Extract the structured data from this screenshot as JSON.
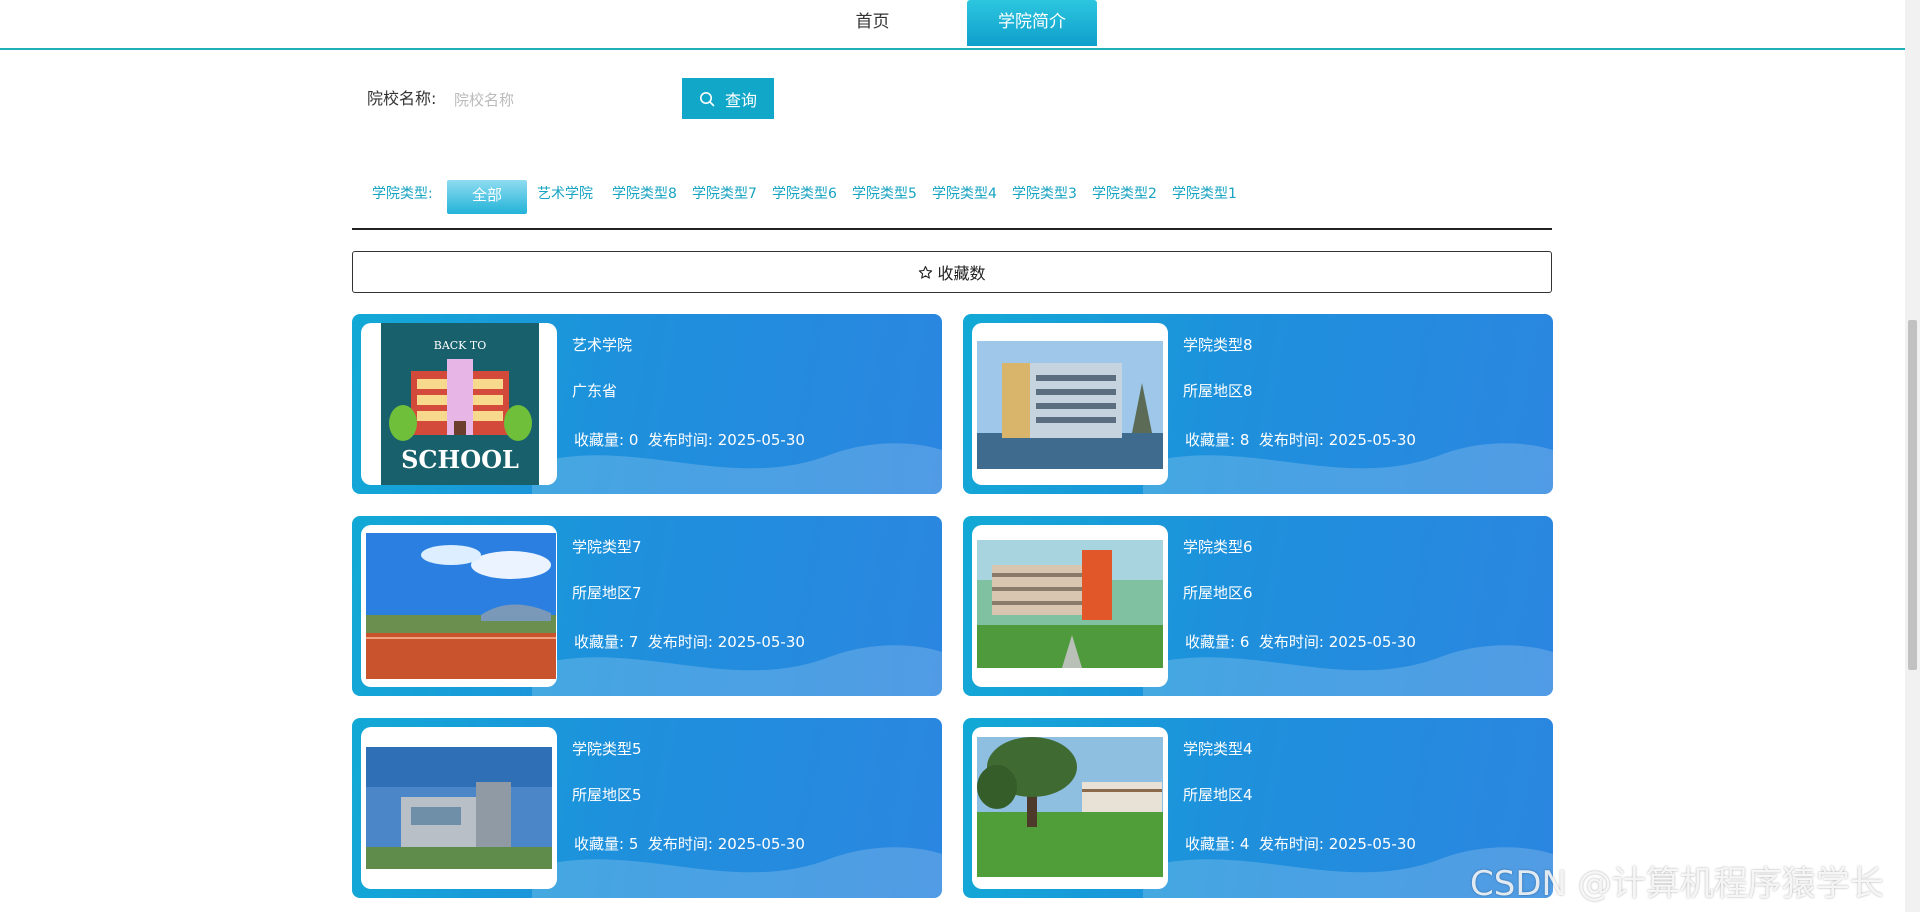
{
  "nav": {
    "items": [
      {
        "label": "首页"
      },
      {
        "label": "学院简介"
      }
    ]
  },
  "search": {
    "label": "院校名称:",
    "placeholder": "院校名称",
    "button_label": "查询",
    "button_icon": "search-icon"
  },
  "filter": {
    "label": "学院类型:",
    "all_label": "全部",
    "items": [
      "艺术学院",
      "学院类型8",
      "学院类型7",
      "学院类型6",
      "学院类型5",
      "学院类型4",
      "学院类型3",
      "学院类型2",
      "学院类型1"
    ]
  },
  "sort": {
    "icon": "star-outline-icon",
    "label": "收藏数"
  },
  "cards": [
    {
      "name": "艺术学院",
      "region": "广东省",
      "favorites_text": "收藏量: 0",
      "date_text": "发布时间: 2025-05-30"
    },
    {
      "name": "学院类型8",
      "region": "所屋地区8",
      "favorites_text": "收藏量: 8",
      "date_text": "发布时间: 2025-05-30"
    },
    {
      "name": "学院类型7",
      "region": "所屋地区7",
      "favorites_text": "收藏量: 7",
      "date_text": "发布时间: 2025-05-30"
    },
    {
      "name": "学院类型6",
      "region": "所屋地区6",
      "favorites_text": "收藏量: 6",
      "date_text": "发布时间: 2025-05-30"
    },
    {
      "name": "学院类型5",
      "region": "所屋地区5",
      "favorites_text": "收藏量: 5",
      "date_text": "发布时间: 2025-05-30"
    },
    {
      "name": "学院类型4",
      "region": "所屋地区4",
      "favorites_text": "收藏量: 4",
      "date_text": "发布时间: 2025-05-30"
    }
  ],
  "thumbnail_text": {
    "back_to": "BACK TO",
    "school": "SCHOOL"
  },
  "watermark": "CSDN @计算机程序猿学长",
  "colors": {
    "accent": "#10a7c9",
    "nav_border": "#1fb0b8",
    "card_start": "#12a9d6",
    "card_end": "#2b86e0",
    "filter_text": "#17a3c2"
  }
}
